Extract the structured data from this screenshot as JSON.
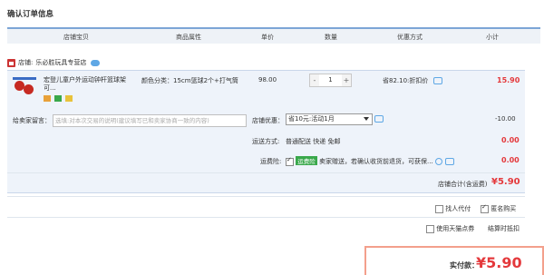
{
  "page": {
    "title": "确认订单信息"
  },
  "table": {
    "headers": [
      "店铺宝贝",
      "商品属性",
      "单价",
      "数量",
      "优惠方式",
      "小计"
    ]
  },
  "shop": {
    "prefix": "店铺:",
    "name": "乐必胜玩具专营店"
  },
  "item": {
    "name": "宏登儿童户外运动钟杆篮球架可...",
    "attr": "颜色分类：15cm篮球2个+打气筒",
    "price": "98.00",
    "quantity": "1",
    "minus": "-",
    "plus": "+",
    "discount": "省82.10:折扣价",
    "subtotal": "15.90"
  },
  "message": {
    "label": "给卖家留言：",
    "placeholder": "选填:对本次交易的说明(建议填写已和卖家协商一致的内容)"
  },
  "shop_discount": {
    "label": "店铺优惠：",
    "selected": "省10元:活动1月",
    "value": "-10.00"
  },
  "shipping": {
    "label": "运送方式:",
    "method": "普通配送 快递 免邮",
    "value": "0.00"
  },
  "insurance": {
    "label": "运费险:",
    "tag": "运费险",
    "desc": "卖家赠送，若确认收货前退货，可获保...",
    "value": "0.00"
  },
  "shop_total": {
    "label": "店铺合计(含运费)",
    "value": "¥5.90"
  },
  "options": {
    "proxy_pay": "找人代付",
    "anonymous": "匿名购买",
    "tmall_points": "使用天猫点券",
    "tmall_points_value": "结算时抵扣"
  },
  "payment": {
    "label": "实付款：",
    "value": "¥5.90"
  },
  "colors": {
    "accent": "#e4393c",
    "header_line": "#7ca5d6",
    "row_bg": "#eef3fa"
  }
}
